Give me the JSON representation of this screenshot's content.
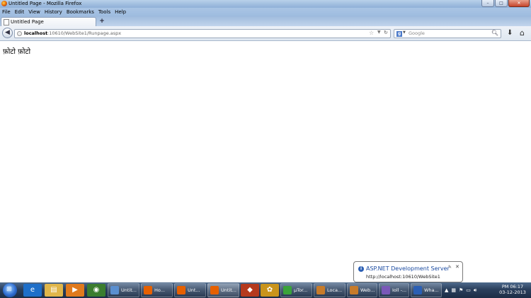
{
  "window": {
    "title": "Untitled Page - Mozilla Firefox",
    "buttons": {
      "minimize": "–",
      "maximize": "□",
      "close": "✕"
    }
  },
  "menubar": {
    "items": [
      "File",
      "Edit",
      "View",
      "History",
      "Bookmarks",
      "Tools",
      "Help"
    ]
  },
  "tabs": [
    {
      "label": "Untitled Page",
      "active": true
    }
  ],
  "new_tab_label": "+",
  "navbar": {
    "back_icon": "back-arrow-icon",
    "url_host": "localhost",
    "url_path": ":10610/WebSite1/Runpage.aspx",
    "search_placeholder": "Google",
    "search_engine_letter": "g"
  },
  "page": {
    "text": "फ़ोटो फ़ोटो"
  },
  "notification": {
    "title": "ASP.NET Development Server",
    "text": "http://localhost:10610/WebSite1"
  },
  "taskbar": {
    "tasks": [
      {
        "label": "Untit...",
        "icon": "explorer-icon"
      },
      {
        "label": "Ho...",
        "icon": "firefox-icon"
      },
      {
        "label": "Unt...",
        "icon": "firefox-icon"
      },
      {
        "label": "Untit...",
        "icon": "firefox-icon"
      },
      {
        "label": "µTor...",
        "icon": "utorrent-icon"
      },
      {
        "label": "Loca...",
        "icon": "aspnet-icon"
      },
      {
        "label": "Web...",
        "icon": "aspnet-icon"
      },
      {
        "label": "Ioll -...",
        "icon": "visual-studio-icon"
      },
      {
        "label": "Wha...",
        "icon": "word-icon"
      }
    ],
    "clock_time": "PM 06:17",
    "clock_date": "03-12-2013"
  },
  "colors": {
    "titlebar": "#a7c3e2",
    "taskbar": "#2a3f5c",
    "link_blue": "#1a4aa0"
  }
}
